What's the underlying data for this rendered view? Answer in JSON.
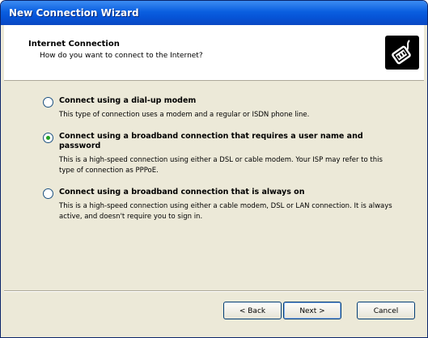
{
  "window": {
    "title": "New Connection Wizard"
  },
  "header": {
    "title": "Internet Connection",
    "subtitle": "How do you want to connect to the Internet?",
    "icon": "connection-cable-icon"
  },
  "options": [
    {
      "label": "Connect using a dial-up modem",
      "description": "This type of connection uses a modem and a regular or ISDN phone line.",
      "selected": false
    },
    {
      "label": "Connect using a broadband connection that requires a user name and password",
      "description": "This is a high-speed connection using either a DSL or cable modem. Your ISP may refer to this type of connection as PPPoE.",
      "selected": true
    },
    {
      "label": "Connect using a broadband connection that is always on",
      "description": "This is a high-speed connection using either a cable modem, DSL or LAN connection. It is always active, and doesn't require you to sign in.",
      "selected": false
    }
  ],
  "buttons": {
    "back": "< Back",
    "next": "Next >",
    "cancel": "Cancel"
  },
  "colors": {
    "titlebar": "#0a5fe0",
    "dialog_bg": "#ece9d8",
    "radio_selected": "#21a121"
  }
}
